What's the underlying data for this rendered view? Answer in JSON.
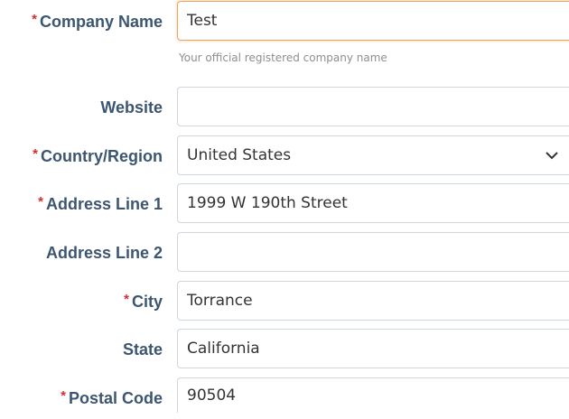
{
  "form": {
    "fields": [
      {
        "label": "Company Name",
        "required": true,
        "value": "Test",
        "hint": "Your official registered company name"
      },
      {
        "label": "Website",
        "required": false,
        "value": ""
      },
      {
        "label": "Country/Region",
        "required": true,
        "value": "United States",
        "type": "select"
      },
      {
        "label": "Address Line 1",
        "required": true,
        "value": "1999 W 190th Street"
      },
      {
        "label": "Address Line 2",
        "required": false,
        "value": ""
      },
      {
        "label": "City",
        "required": true,
        "value": "Torrance"
      },
      {
        "label": "State",
        "required": false,
        "value": "California"
      },
      {
        "label": "Postal Code",
        "required": true,
        "value": "90504"
      }
    ],
    "required_marker": "*",
    "colors": {
      "label": "#3d5670",
      "required": "#d32f2f",
      "focus_border": "#f0a25b",
      "border": "#cfd6dd"
    },
    "icons": {
      "select": "chevron-down-icon"
    }
  }
}
